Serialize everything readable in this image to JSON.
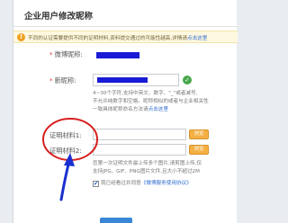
{
  "header": {
    "title": "企业用户修改昵称"
  },
  "notice": {
    "text": "不同的认证需要提供不同的证明材料,资料提交通过的可能性越高,详情请",
    "link": "点击这里"
  },
  "form": {
    "weibo_nick": {
      "label": "微博昵称:",
      "required": true
    },
    "new_nick": {
      "label": "新昵称:",
      "required": true
    },
    "new_nick_hint": {
      "line1": "4~30个字符,支持中英文、数字、\"_\"或者减号,",
      "line2": "不允许纯数字和空格。昵称相似的或者与企业相关性",
      "line3": "一致",
      "line3_rest": "具体昵称命名方法请",
      "link": "点击这里"
    },
    "proof1": {
      "label": "证明材料1:",
      "button": "浏览"
    },
    "proof2": {
      "label": "证明材料2:",
      "button": "浏览"
    },
    "upload_hint": {
      "line1": "您第一次证明文件最上传多个图片,请剪图上传,仅",
      "line2": "支持JPG、GIF、PNG图片文件,且大小不超过2M"
    },
    "agree": {
      "label": "我已经看过并同意",
      "link": "《微博服务使用协议》",
      "checked": true
    }
  },
  "colors": {
    "highlight_bar": "#1a1ad6",
    "annotation_red": "#d81e1e",
    "annotation_arrow": "#1a2fd0",
    "button_orange": "#f4b043"
  }
}
